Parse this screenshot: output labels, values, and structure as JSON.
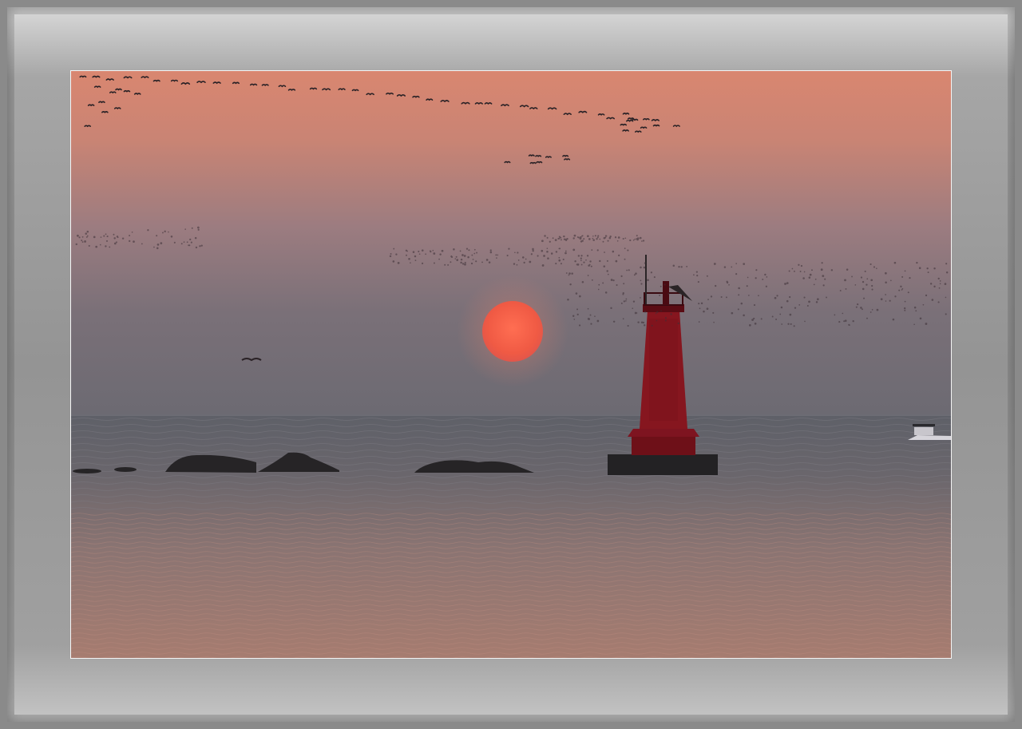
{
  "photo": {
    "subject": "",
    "colors": {
      "sky_top": "#d8846c",
      "sky_mid": "#a07a7c",
      "sky_low": "#6f6c74",
      "sun": "#f2644a",
      "sea": "#64646c",
      "sea_glow": "#b58272",
      "lighthouse": "#8a1620",
      "silhouette": "#262426",
      "frame": "#8e8e8e"
    }
  }
}
